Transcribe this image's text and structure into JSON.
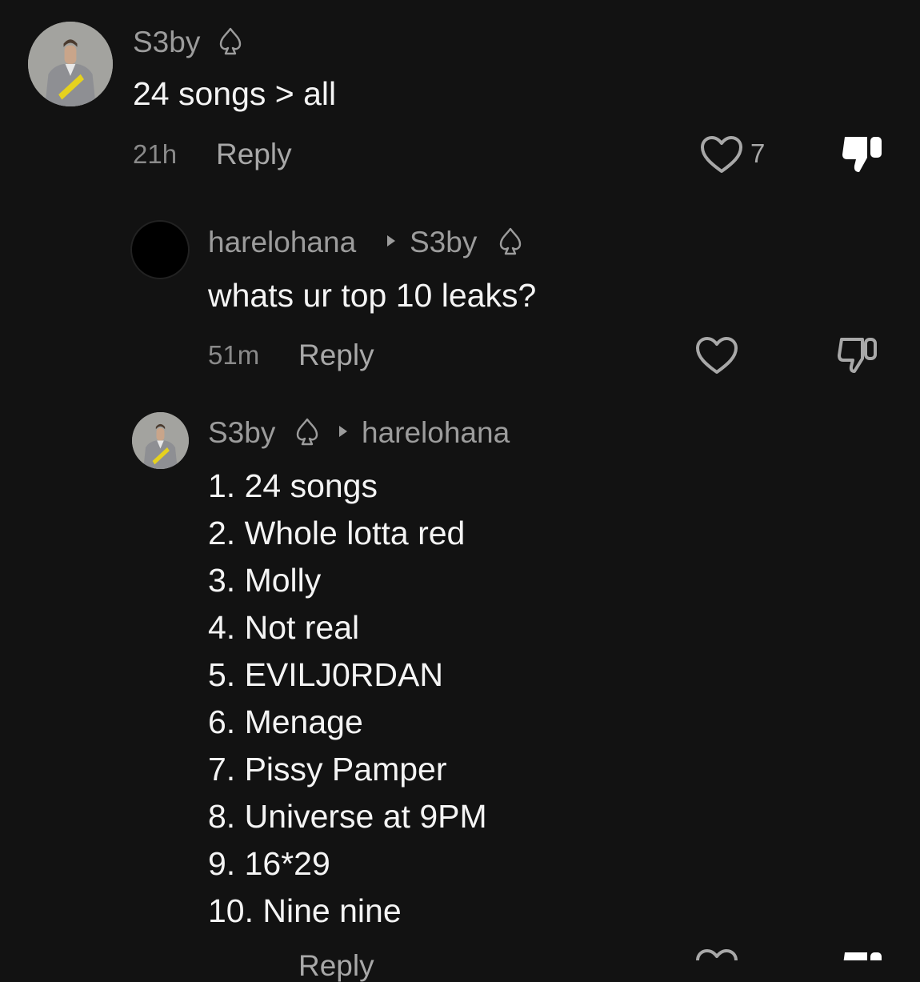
{
  "comments": [
    {
      "user": "S3by",
      "text": "24 songs > all",
      "time": "21h",
      "reply_label": "Reply",
      "likes": "7",
      "disliked": true
    },
    {
      "user": "harelohana",
      "reply_to": "S3by",
      "text": "whats ur top 10 leaks?",
      "time": "51m",
      "reply_label": "Reply",
      "disliked": false
    },
    {
      "user": "S3by",
      "reply_to": "harelohana",
      "lines": [
        "1. 24 songs",
        "2. Whole lotta red",
        "3. Molly",
        "4. Not real",
        "5. EVILJ0RDAN",
        "6. Menage",
        "7. Pissy Pamper",
        "8. Universe at 9PM",
        "9. 16*29",
        "10. Nine nine"
      ],
      "time": "",
      "reply_label": "Reply"
    }
  ],
  "colors": {
    "background": "#121212",
    "username": "#9c9c9c",
    "text": "#f4f4f4",
    "meta": "#8a8a8a"
  },
  "icons": {
    "like": "heart-outline-icon",
    "dislike_filled": "thumbs-down-filled-icon",
    "dislike": "thumbs-down-outline-icon",
    "badge": "spade-icon",
    "reply_arrow": "triangle-right-icon"
  }
}
